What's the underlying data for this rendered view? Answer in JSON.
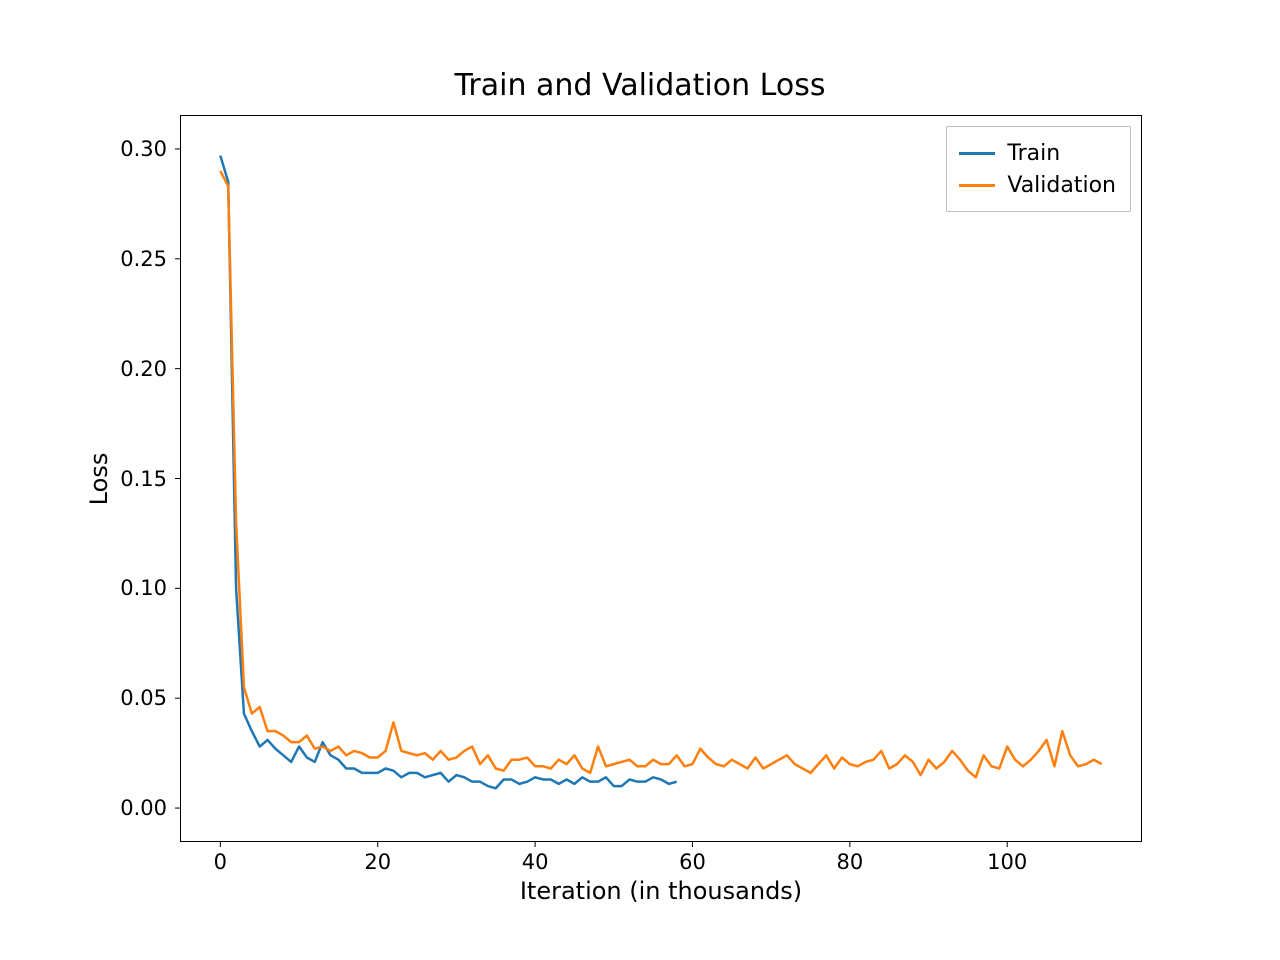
{
  "chart_data": {
    "type": "line",
    "title": "Train and Validation Loss",
    "xlabel": "Iteration (in thousands)",
    "ylabel": "Loss",
    "xlim": [
      -5,
      117
    ],
    "ylim": [
      -0.015,
      0.315
    ],
    "xticks": [
      0,
      20,
      40,
      60,
      80,
      100
    ],
    "yticks": [
      0.0,
      0.05,
      0.1,
      0.15,
      0.2,
      0.25,
      0.3
    ],
    "ytick_labels": [
      "0.00",
      "0.05",
      "0.10",
      "0.15",
      "0.20",
      "0.25",
      "0.30"
    ],
    "series": [
      {
        "name": "Train",
        "color": "#1f77b4",
        "x": [
          0,
          1,
          2,
          3,
          4,
          5,
          6,
          7,
          8,
          9,
          10,
          11,
          12,
          13,
          14,
          15,
          16,
          17,
          18,
          19,
          20,
          21,
          22,
          23,
          24,
          25,
          26,
          27,
          28,
          29,
          30,
          31,
          32,
          33,
          34,
          35,
          36,
          37,
          38,
          39,
          40,
          41,
          42,
          43,
          44,
          45,
          46,
          47,
          48,
          49,
          50,
          51,
          52,
          53,
          54,
          55,
          56,
          57,
          58
        ],
        "y": [
          0.297,
          0.285,
          0.1,
          0.043,
          0.035,
          0.028,
          0.031,
          0.027,
          0.024,
          0.021,
          0.028,
          0.023,
          0.021,
          0.03,
          0.024,
          0.022,
          0.018,
          0.018,
          0.016,
          0.016,
          0.016,
          0.018,
          0.017,
          0.014,
          0.016,
          0.016,
          0.014,
          0.015,
          0.016,
          0.012,
          0.015,
          0.014,
          0.012,
          0.012,
          0.01,
          0.009,
          0.013,
          0.013,
          0.011,
          0.012,
          0.014,
          0.013,
          0.013,
          0.011,
          0.013,
          0.011,
          0.014,
          0.012,
          0.012,
          0.014,
          0.01,
          0.01,
          0.013,
          0.012,
          0.012,
          0.014,
          0.013,
          0.011,
          0.012
        ]
      },
      {
        "name": "Validation",
        "color": "#ff7f0e",
        "x": [
          0,
          1,
          2,
          3,
          4,
          5,
          6,
          7,
          8,
          9,
          10,
          11,
          12,
          13,
          14,
          15,
          16,
          17,
          18,
          19,
          20,
          21,
          22,
          23,
          24,
          25,
          26,
          27,
          28,
          29,
          30,
          31,
          32,
          33,
          34,
          35,
          36,
          37,
          38,
          39,
          40,
          41,
          42,
          43,
          44,
          45,
          46,
          47,
          48,
          49,
          50,
          51,
          52,
          53,
          54,
          55,
          56,
          57,
          58,
          59,
          60,
          61,
          62,
          63,
          64,
          65,
          66,
          67,
          68,
          69,
          70,
          71,
          72,
          73,
          74,
          75,
          76,
          77,
          78,
          79,
          80,
          81,
          82,
          83,
          84,
          85,
          86,
          87,
          88,
          89,
          90,
          91,
          92,
          93,
          94,
          95,
          96,
          97,
          98,
          99,
          100,
          101,
          102,
          103,
          104,
          105,
          106,
          107,
          108,
          109,
          110,
          111,
          112
        ],
        "y": [
          0.29,
          0.283,
          0.13,
          0.055,
          0.043,
          0.046,
          0.035,
          0.035,
          0.033,
          0.03,
          0.03,
          0.033,
          0.027,
          0.028,
          0.026,
          0.028,
          0.024,
          0.026,
          0.025,
          0.023,
          0.023,
          0.026,
          0.039,
          0.026,
          0.025,
          0.024,
          0.025,
          0.022,
          0.026,
          0.022,
          0.023,
          0.026,
          0.028,
          0.02,
          0.024,
          0.018,
          0.017,
          0.022,
          0.022,
          0.023,
          0.019,
          0.019,
          0.018,
          0.022,
          0.02,
          0.024,
          0.018,
          0.016,
          0.028,
          0.019,
          0.02,
          0.021,
          0.022,
          0.019,
          0.019,
          0.022,
          0.02,
          0.02,
          0.024,
          0.019,
          0.02,
          0.027,
          0.023,
          0.02,
          0.019,
          0.022,
          0.02,
          0.018,
          0.023,
          0.018,
          0.02,
          0.022,
          0.024,
          0.02,
          0.018,
          0.016,
          0.02,
          0.024,
          0.018,
          0.023,
          0.02,
          0.019,
          0.021,
          0.022,
          0.026,
          0.018,
          0.02,
          0.024,
          0.021,
          0.015,
          0.022,
          0.018,
          0.021,
          0.026,
          0.022,
          0.017,
          0.014,
          0.024,
          0.019,
          0.018,
          0.028,
          0.022,
          0.019,
          0.022,
          0.026,
          0.031,
          0.019,
          0.035,
          0.024,
          0.019,
          0.02,
          0.022,
          0.02
        ]
      }
    ],
    "legend": [
      "Train",
      "Validation"
    ],
    "legend_loc": "upper right"
  }
}
